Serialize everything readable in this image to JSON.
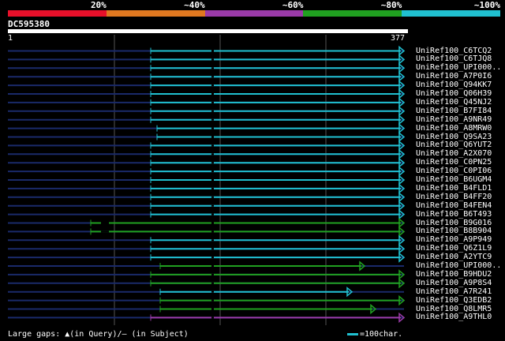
{
  "legend": {
    "segments": [
      {
        "label": "20%",
        "color": "#e8102a"
      },
      {
        "label": "~40%",
        "color": "#e07820"
      },
      {
        "label": "~60%",
        "color": "#9a3aa8"
      },
      {
        "label": "~80%",
        "color": "#20a020"
      },
      {
        "label": "~100%",
        "color": "#20c0d0"
      }
    ]
  },
  "query": {
    "id": "DC595380",
    "start": "1",
    "end": "377"
  },
  "hits": [
    {
      "label": "UniRef100_C6TCQ2",
      "color": "#20c0d0"
    },
    {
      "label": "UniRef100_C6TJQ8",
      "color": "#20c0d0"
    },
    {
      "label": "UniRef100_UPI000..",
      "color": "#20c0d0"
    },
    {
      "label": "UniRef100_A7P0I6",
      "color": "#20c0d0"
    },
    {
      "label": "UniRef100_Q94KK7",
      "color": "#20c0d0"
    },
    {
      "label": "UniRef100_Q06H39",
      "color": "#20c0d0"
    },
    {
      "label": "UniRef100_Q45NJ2",
      "color": "#20c0d0"
    },
    {
      "label": "UniRef100_B7FI84",
      "color": "#20c0d0"
    },
    {
      "label": "UniRef100_A9NR49",
      "color": "#20c0d0"
    },
    {
      "label": "UniRef100_A8MRW0",
      "color": "#20c0d0"
    },
    {
      "label": "UniRef100_Q9SA23",
      "color": "#20c0d0"
    },
    {
      "label": "UniRef100_Q6YUT2",
      "color": "#20c0d0"
    },
    {
      "label": "UniRef100_A2X070",
      "color": "#20c0d0"
    },
    {
      "label": "UniRef100_C0PN25",
      "color": "#20c0d0"
    },
    {
      "label": "UniRef100_C0PI06",
      "color": "#20c0d0"
    },
    {
      "label": "UniRef100_B6UGM4",
      "color": "#20c0d0"
    },
    {
      "label": "UniRef100_B4FLD1",
      "color": "#20c0d0"
    },
    {
      "label": "UniRef100_B4FF20",
      "color": "#20c0d0"
    },
    {
      "label": "UniRef100_B4FEN4",
      "color": "#20c0d0"
    },
    {
      "label": "UniRef100_B6T493",
      "color": "#20c0d0"
    },
    {
      "label": "UniRef100_B9G016",
      "color": "#20a020"
    },
    {
      "label": "UniRef100_B8B904",
      "color": "#20a020"
    },
    {
      "label": "UniRef100_A9P949",
      "color": "#20c0d0"
    },
    {
      "label": "UniRef100_Q6Z1L9",
      "color": "#20c0d0"
    },
    {
      "label": "UniRef100_A2YTC9",
      "color": "#20c0d0"
    },
    {
      "label": "UniRef100_UPI000..",
      "color": "#20a020"
    },
    {
      "label": "UniRef100_B9HDU2",
      "color": "#20a020"
    },
    {
      "label": "UniRef100_A9P8S4",
      "color": "#20a020"
    },
    {
      "label": "UniRef100_A7R241",
      "color": "#20c0d0"
    },
    {
      "label": "UniRef100_Q3EDB2",
      "color": "#20a020"
    },
    {
      "label": "UniRef100_Q8LMR5",
      "color": "#20a020"
    },
    {
      "label": "UniRef100_A9THL0",
      "color": "#9a3aa8"
    }
  ],
  "footer": {
    "gaps_text": "Large gaps: ▲(in Query)/– (in Subject)",
    "scale_text": "=100char."
  }
}
